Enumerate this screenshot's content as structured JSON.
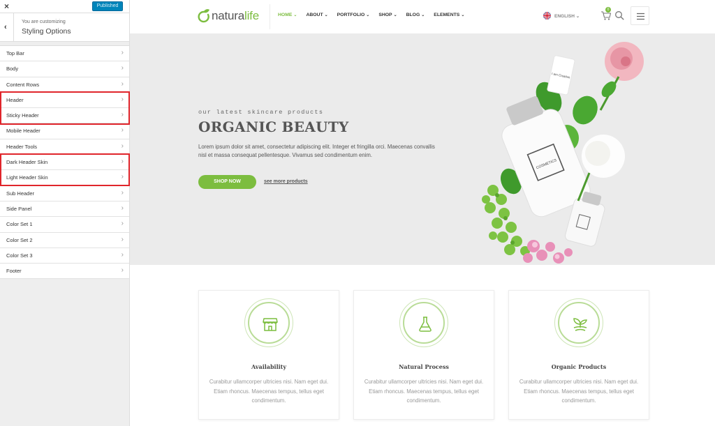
{
  "customizer": {
    "close_icon": "×",
    "publish_label": "Published",
    "back_icon": "‹",
    "subtitle": "You are customizing",
    "title": "Styling Options",
    "chevron": "›",
    "items": [
      {
        "label": "Top Bar"
      },
      {
        "label": "Body"
      },
      {
        "label": "Content Rows"
      },
      {
        "label": "Header"
      },
      {
        "label": "Sticky Header"
      },
      {
        "label": "Mobile Header"
      },
      {
        "label": "Header Tools"
      },
      {
        "label": "Dark Header Skin"
      },
      {
        "label": "Light Header Skin"
      },
      {
        "label": "Sub Header"
      },
      {
        "label": "Side Panel"
      },
      {
        "label": "Color Set 1"
      },
      {
        "label": "Color Set 2"
      },
      {
        "label": "Color Set 3"
      },
      {
        "label": "Footer"
      }
    ],
    "highlight_color": "#e0252b"
  },
  "site": {
    "logo": {
      "part1": "natura",
      "part2": "life"
    },
    "nav": [
      {
        "label": "HOME"
      },
      {
        "label": "ABOUT"
      },
      {
        "label": "PORTFOLIO"
      },
      {
        "label": "SHOP"
      },
      {
        "label": "BLOG"
      },
      {
        "label": "ELEMENTS"
      }
    ],
    "nav_caret": "⌄",
    "language": "ENGLISH",
    "cart_count": "0",
    "hero": {
      "kicker": "our latest skincare products",
      "title": "ORGANIC BEAUTY",
      "text": "Lorem ipsum dolor sit amet, consectetur adipiscing elit. Integer et fringilla orci. Maecenas convallis nisl et massa consequat pellentesque. Vivamus sed condimentum enim.",
      "cta": "SHOP NOW",
      "link": "see more products",
      "bottle_label": "COSMETICS",
      "tag_label": "I am Creative"
    },
    "features": [
      {
        "icon": "store-icon",
        "title": "Availability",
        "text": "Curabitur ullamcorper ultricies nisi. Nam eget dui. Etiam rhoncus. Maecenas tempus, tellus eget condimentum."
      },
      {
        "icon": "flask-icon",
        "title": "Natural Process",
        "text": "Curabitur ullamcorper ultricies nisi. Nam eget dui. Etiam rhoncus. Maecenas tempus, tellus eget condimentum."
      },
      {
        "icon": "sprout-icon",
        "title": "Organic Products",
        "text": "Curabitur ullamcorper ultricies nisi. Nam eget dui. Etiam rhoncus. Maecenas tempus, tellus eget condimentum."
      }
    ],
    "accent_color": "#7cbd3f"
  }
}
